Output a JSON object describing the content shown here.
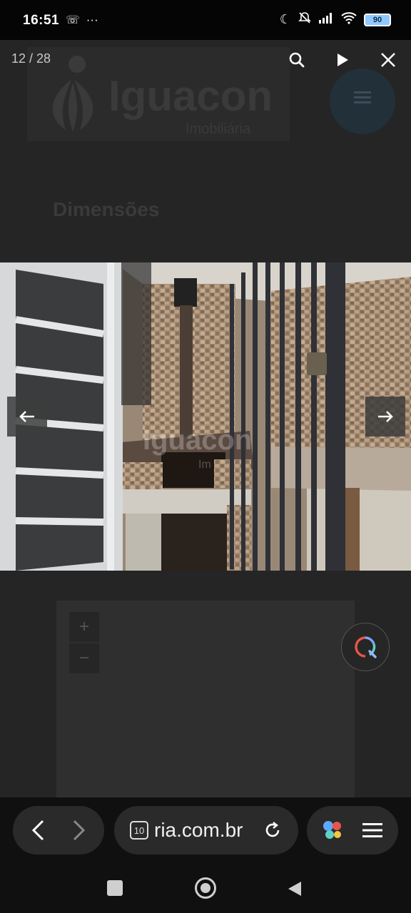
{
  "status_bar": {
    "time": "16:51",
    "dots": "···",
    "battery": "90"
  },
  "page": {
    "logo_name": "Iguacon",
    "logo_sub": "Imobiliária",
    "section_heading": "Dimensões"
  },
  "lightbox": {
    "counter": "12 / 28",
    "watermark": "Iguacon",
    "watermark_sub": "Im"
  },
  "map": {
    "zoom_in": "+",
    "zoom_out": "−"
  },
  "browser": {
    "url": "ria.com.br",
    "tab_count": "10"
  },
  "icons": {
    "search": "search-icon",
    "play": "play-icon",
    "close": "close-icon",
    "prev": "arrow-left-icon",
    "next": "arrow-right-icon",
    "lens": "lens-icon",
    "reload": "reload-icon",
    "menu": "hamburger-icon"
  },
  "colors": {
    "accent": "#8fc9ff",
    "page_bg": "#252525",
    "bar_bg": "#101010"
  }
}
